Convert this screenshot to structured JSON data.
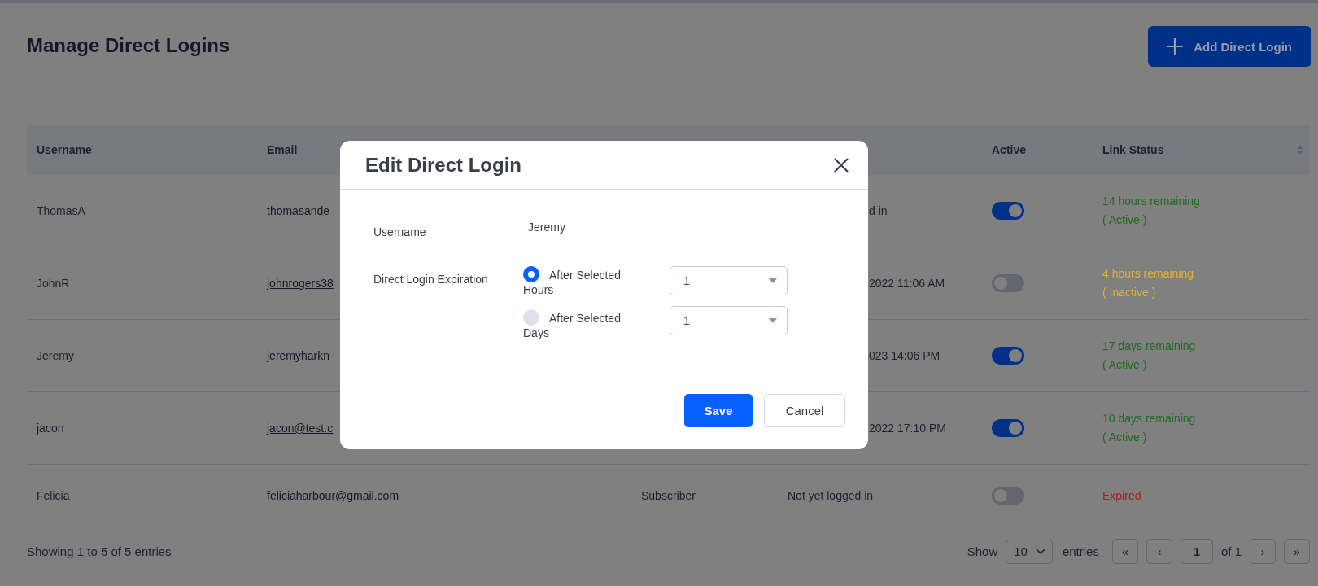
{
  "page": {
    "title": "Manage Direct Logins",
    "add_button": "Add Direct Login"
  },
  "table": {
    "columns": [
      {
        "label": "Username",
        "sortable": false
      },
      {
        "label": "Email",
        "sortable": false
      },
      {
        "label": "Active",
        "sortable": false
      },
      {
        "label": "Link Status",
        "sortable": true
      }
    ],
    "rows": [
      {
        "username": "ThomasA",
        "email": "thomasande",
        "last_login": "d in",
        "active": true,
        "status": "14 hours remaining",
        "status_note": "( Active )",
        "color": "#1f6b1f"
      },
      {
        "username": "JohnR",
        "email": "johnrogers38",
        "last_login": "2022 11:06 AM",
        "active": false,
        "status": "4 hours remaining",
        "status_note": "( Inactive )",
        "color": "#e0b030"
      },
      {
        "username": "Jeremy",
        "email": "jeremyharkn",
        "last_login": "023 14:06 PM",
        "active": true,
        "status": "17 days remaining",
        "status_note": "( Active )",
        "color": "#1f6b1f"
      },
      {
        "username": "jacon",
        "email": "jacon@test.c",
        "last_login": "2022 17:10 PM",
        "active": true,
        "status": "10 days remaining",
        "status_note": "( Active )",
        "color": "#1f6b1f"
      },
      {
        "username": "Felicia",
        "email": "feliciaharbour@gmail.com",
        "role": "Subscriber",
        "last_login": "Not yet logged in",
        "active": false,
        "status": "Expired",
        "color": "#b01c1c"
      }
    ],
    "info": "Showing 1 to 5 of 5 entries"
  },
  "pagination": {
    "show_label": "Show",
    "page_size": "10",
    "entries_label": "entries",
    "first": "«",
    "prev": "‹",
    "page": "1",
    "of": "of 1",
    "next": "›",
    "last": "»"
  },
  "dialog": {
    "title": "Edit Direct Login",
    "username_label": "Username",
    "username_value": "Jeremy",
    "expiration_label": "Direct Login Expiration",
    "options": [
      {
        "label": "After Selected Hours",
        "selected": true,
        "value": "1"
      },
      {
        "label": "After Selected Days",
        "selected": false,
        "value": "1"
      }
    ],
    "buttons": [
      {
        "label": "Save",
        "kind": "primary"
      },
      {
        "label": "Cancel",
        "kind": "secondary"
      }
    ]
  }
}
